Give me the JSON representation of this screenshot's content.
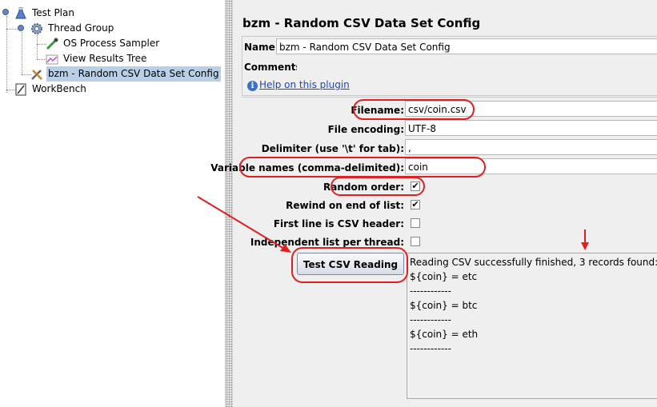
{
  "tree": {
    "items": [
      {
        "label": "Test Plan",
        "icon": "test-plan-flask-icon"
      },
      {
        "label": "Thread Group",
        "icon": "thread-group-gear-icon"
      },
      {
        "label": "OS Process Sampler",
        "icon": "pipette-sampler-icon"
      },
      {
        "label": "View Results Tree",
        "icon": "results-graph-icon"
      },
      {
        "label": "bzm - Random CSV Data Set Config",
        "icon": "wrench-config-icon"
      },
      {
        "label": "WorkBench",
        "icon": "workbench-notebook-icon"
      }
    ]
  },
  "panel": {
    "title": "bzm - Random CSV Data Set Config",
    "name_label": "Name:",
    "name_value": "bzm - Random CSV Data Set Config",
    "comments_label": "Comments:",
    "comments_value": "",
    "help_text": "Help on this plugin",
    "filename_label": "Filename:",
    "filename_value": "csv/coin.csv",
    "encoding_label": "File encoding:",
    "encoding_value": "UTF-8",
    "delimiter_label": "Delimiter (use '\\t' for tab):",
    "delimiter_value": ",",
    "varnames_label": "Variable names (comma-delimited):",
    "varnames_value": "coin",
    "random_label": "Random order:",
    "random_checked": true,
    "rewind_label": "Rewind on end of list:",
    "rewind_checked": true,
    "header_label": "First line is CSV header:",
    "header_checked": false,
    "independent_label": "Independent list per thread:",
    "independent_checked": false,
    "test_button": "Test CSV Reading",
    "result_lines": [
      "Reading CSV successfully finished, 3 records found:",
      "${coin} = etc",
      "------------",
      "${coin} = btc",
      "------------",
      "${coin} = eth",
      "------------"
    ]
  },
  "colors": {
    "annotation": "#e02020",
    "selection": "#b8cfe5",
    "link": "#1a47c7"
  }
}
